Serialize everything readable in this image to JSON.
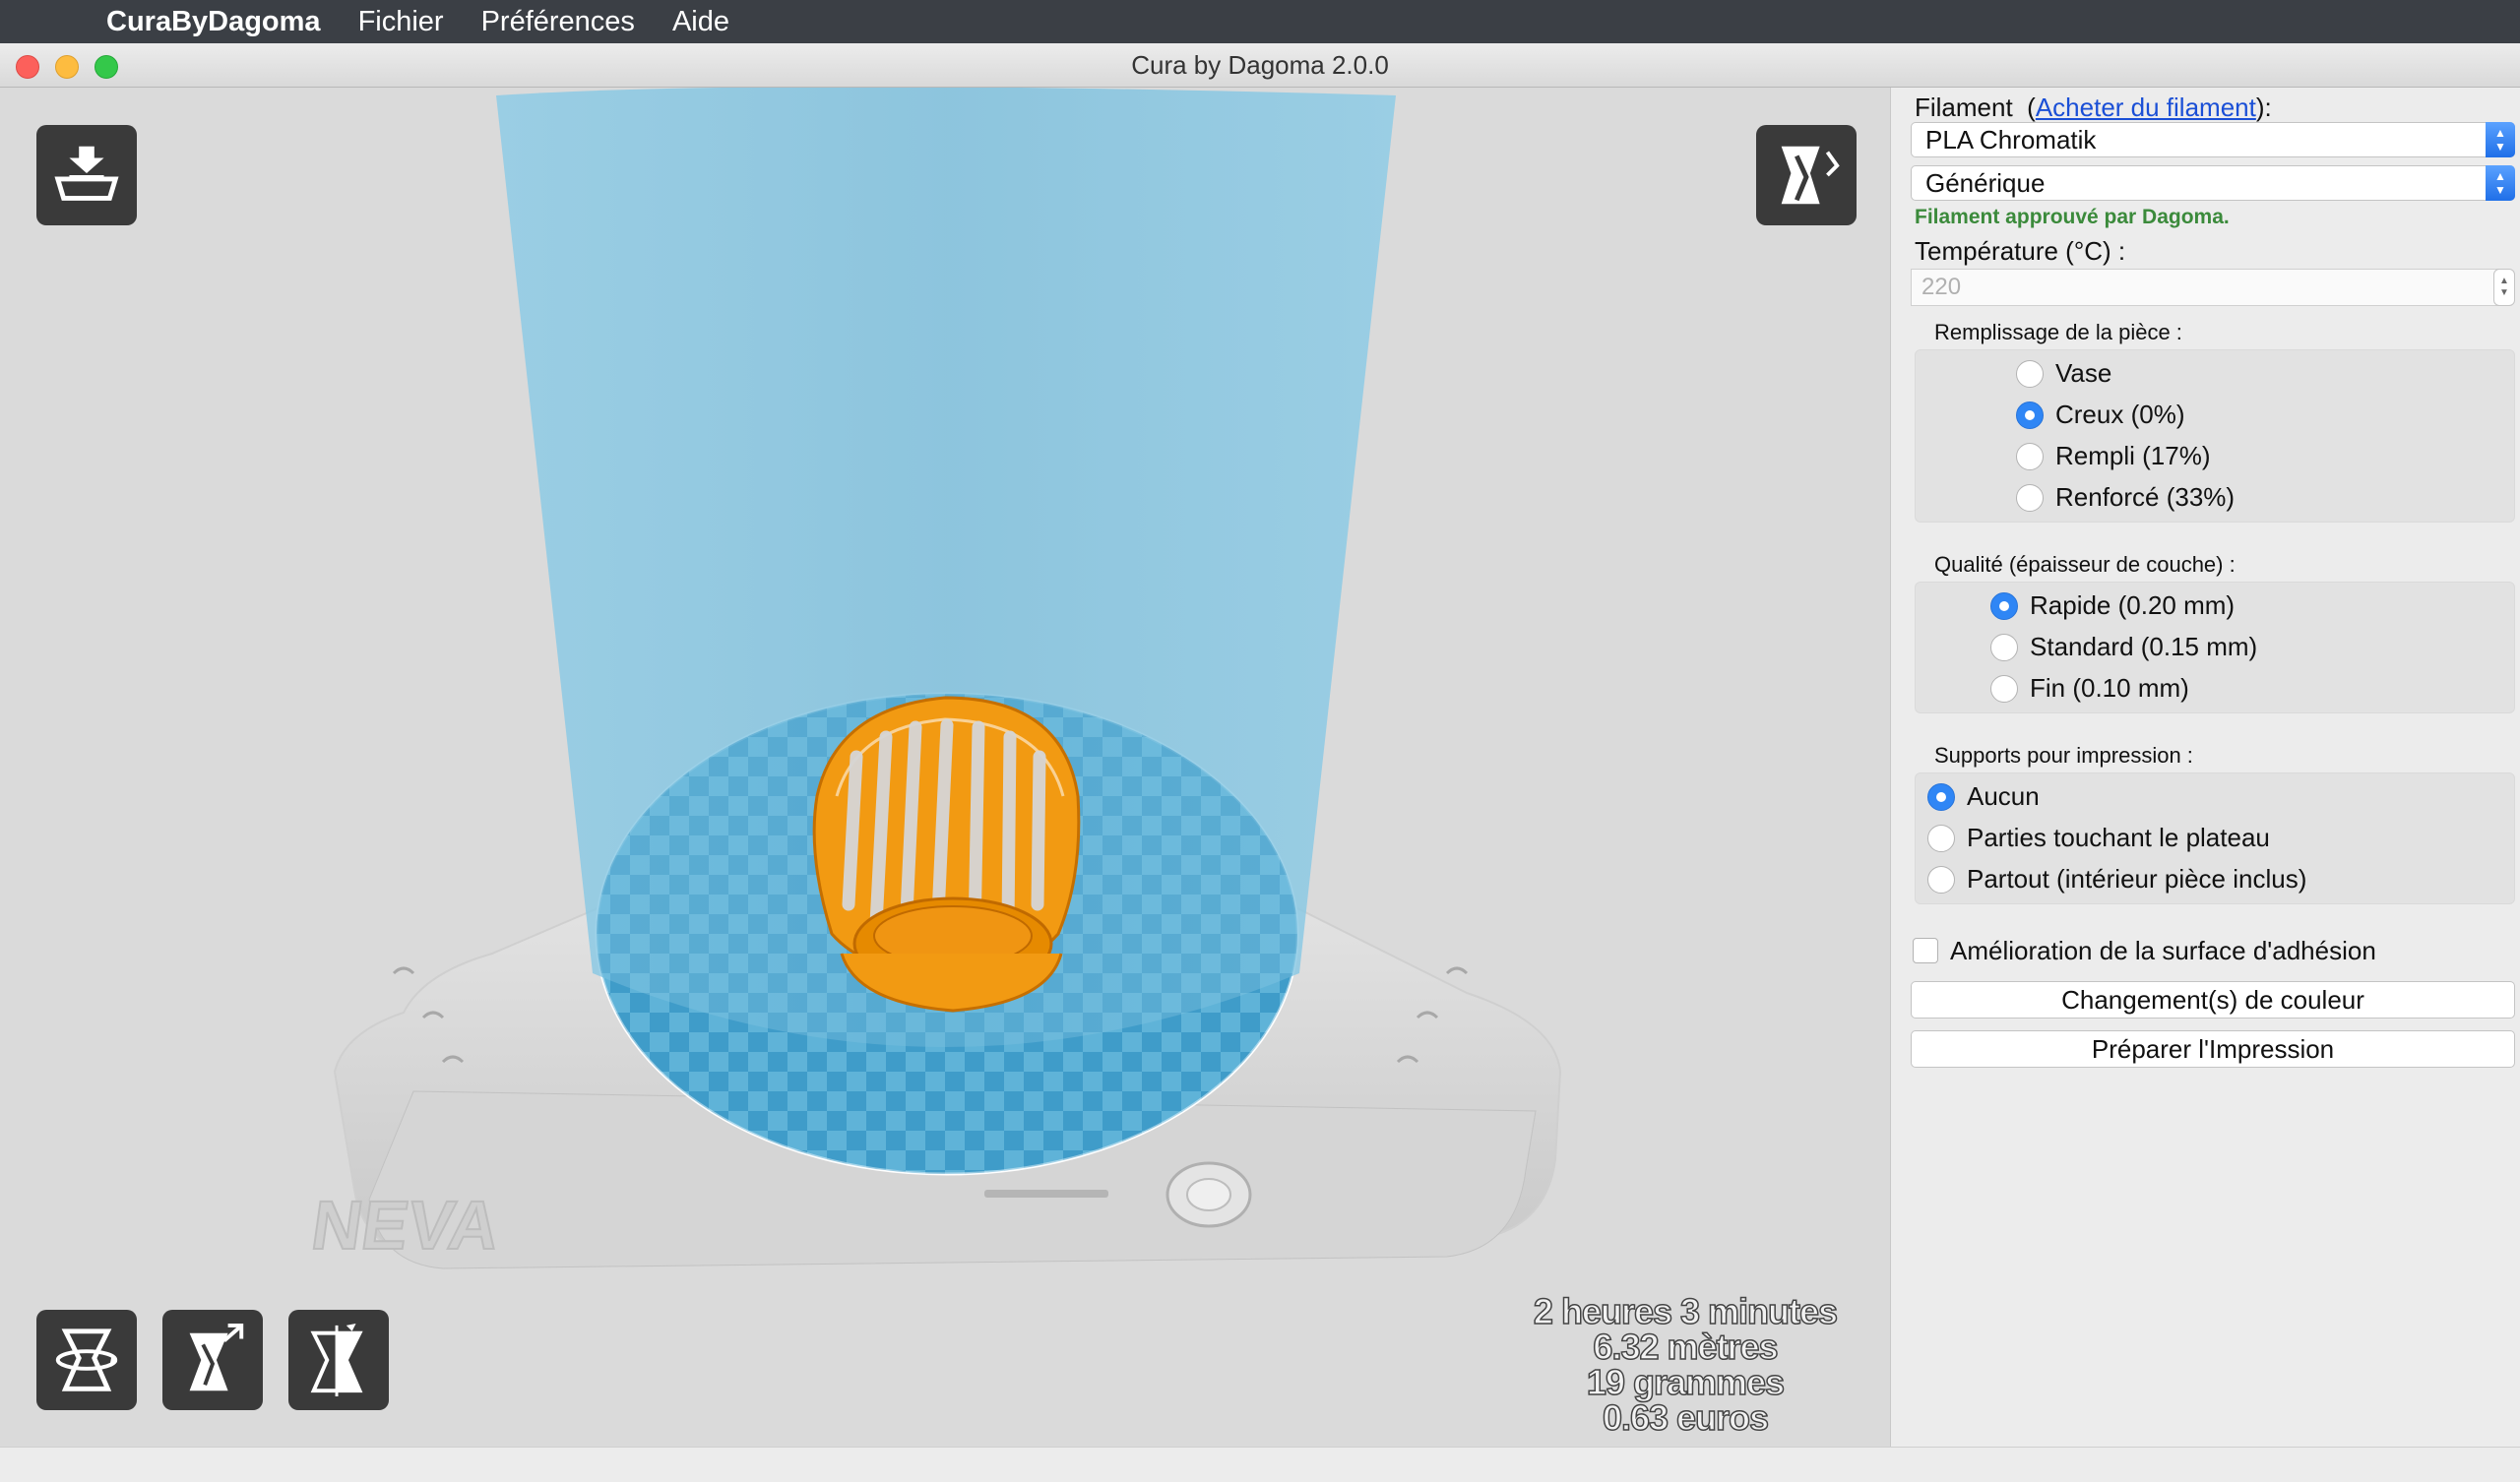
{
  "menubar": {
    "app_name": "CuraByDagoma",
    "items": [
      "Fichier",
      "Préférences",
      "Aide"
    ]
  },
  "window": {
    "title": "Cura by Dagoma 2.0.0"
  },
  "viewport": {
    "model_color": "#f29300",
    "build_volume_color": "#6fbfe0",
    "printer_name": "NEVA",
    "stats": {
      "time": "2 heures 3 minutes",
      "length": "6.32 mètres",
      "weight": "19 grammes",
      "cost": "0.63 euros"
    },
    "tools": {
      "load": "load-model-icon",
      "view": "view-mode-icon",
      "rotate": "rotate-icon",
      "scale": "scale-icon",
      "mirror": "mirror-icon"
    }
  },
  "panel": {
    "filament_label": "Filament",
    "filament_paren_open": "(",
    "filament_link": "Acheter du filament",
    "filament_paren_close": "):",
    "filament_type": "PLA Chromatik",
    "filament_color": "Générique",
    "approved": "Filament approuvé par Dagoma.",
    "temperature_label": "Température (°C) :",
    "temperature_placeholder": "220",
    "fill": {
      "title": "Remplissage de la pièce :",
      "options": [
        "Vase",
        "Creux (0%)",
        "Rempli (17%)",
        "Renforcé (33%)"
      ],
      "selected": 1
    },
    "quality": {
      "title": "Qualité (épaisseur de couche) :",
      "options": [
        "Rapide (0.20 mm)",
        "Standard (0.15 mm)",
        "Fin (0.10 mm)"
      ],
      "selected": 0
    },
    "supports": {
      "title": "Supports pour impression :",
      "options": [
        "Aucun",
        "Parties touchant le plateau",
        "Partout (intérieur pièce inclus)"
      ],
      "selected": 0
    },
    "adhesion_label": "Amélioration de la surface d'adhésion",
    "adhesion_checked": false,
    "color_change_button": "Changement(s) de couleur",
    "prepare_button": "Préparer l'Impression"
  }
}
